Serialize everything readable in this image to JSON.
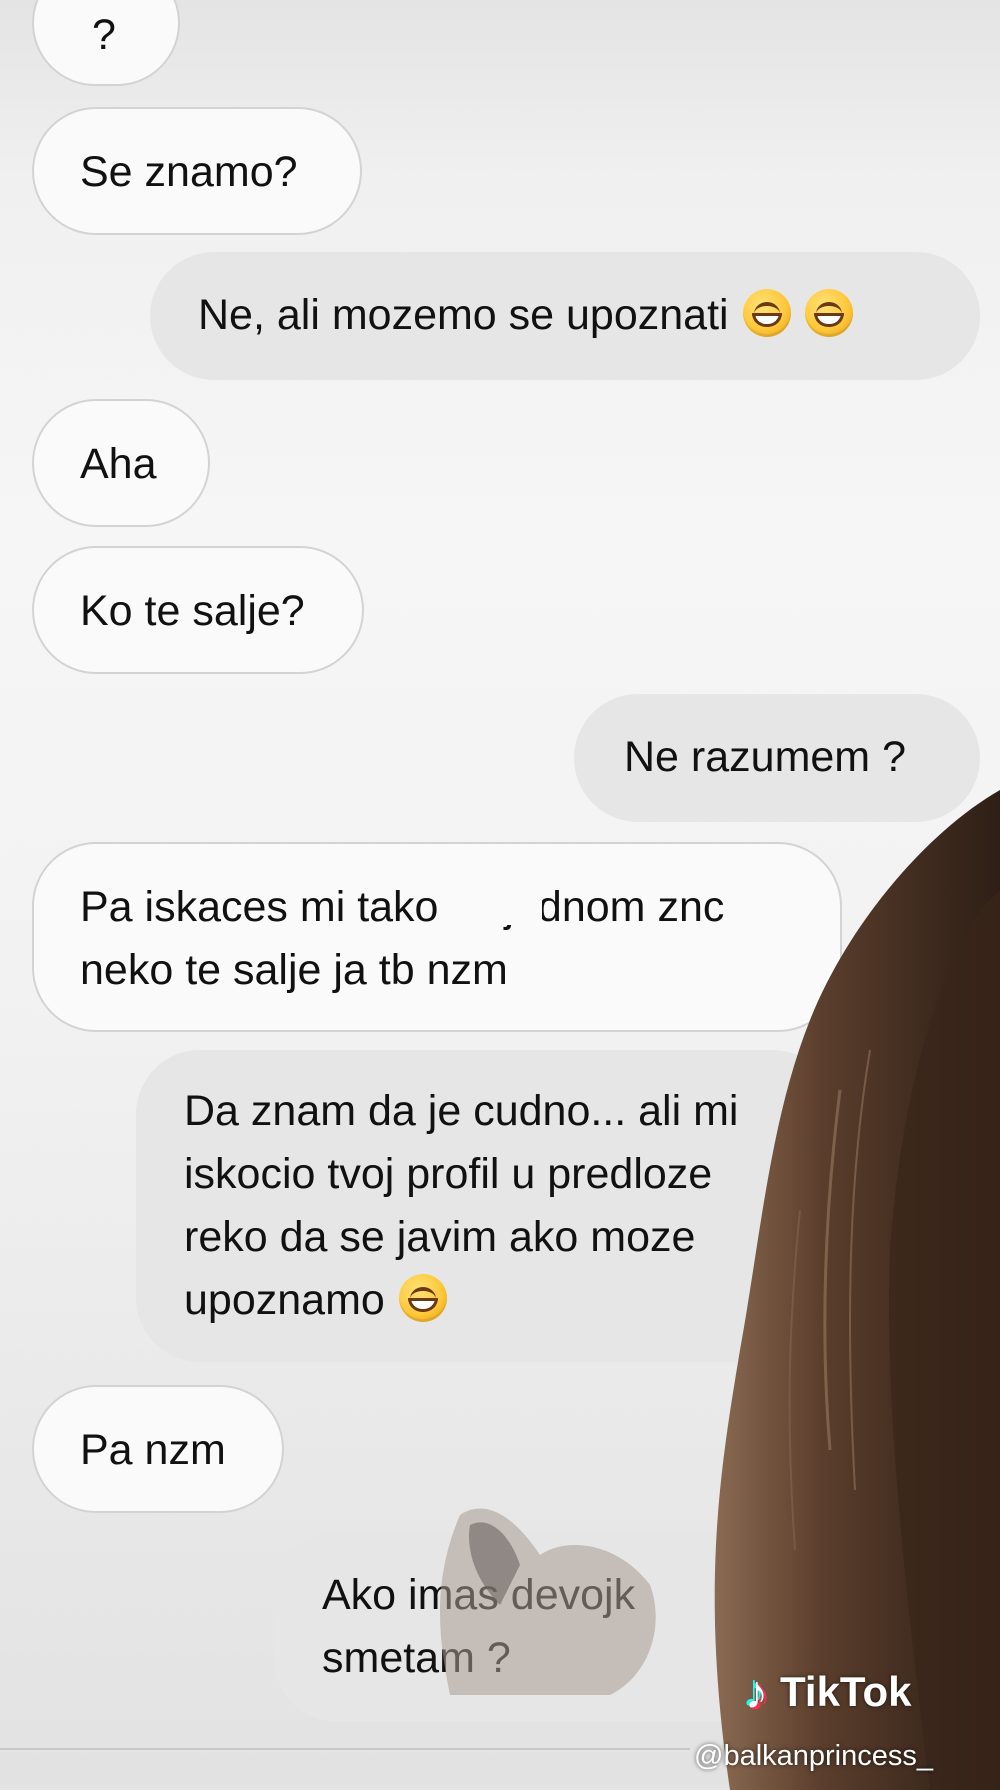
{
  "messages": [
    {
      "side": "in",
      "text": "?"
    },
    {
      "side": "in",
      "text": "Se znamo?"
    },
    {
      "side": "out",
      "text": "Ne, ali mozemo se upoznati",
      "emoji": [
        "grinning-face",
        "grinning-face"
      ]
    },
    {
      "side": "in",
      "text": "Aha"
    },
    {
      "side": "in",
      "text": "Ko te salje?"
    },
    {
      "side": "out",
      "text": "Ne razumem ?"
    },
    {
      "side": "in",
      "lines": [
        "Pa iskaces mi tako",
        "jednom znc",
        "neko te salje ja tb nzm"
      ]
    },
    {
      "side": "out",
      "lines": [
        "Da znam da je cudno... ali mi",
        "iskocio tvoj profil u predloze",
        "reko da se javim ako moze",
        "upoznamo"
      ],
      "emoji": [
        "grinning-face"
      ]
    },
    {
      "side": "in",
      "text": "Pa nzm"
    },
    {
      "side": "out",
      "lines": [
        "Ako imas devojk",
        "smetam ?"
      ]
    }
  ],
  "watermark": {
    "brand": "TikTok",
    "handle": "@balkanprincess_"
  },
  "colors": {
    "incoming_bubble": "#fafafa",
    "outgoing_bubble": "#e6e6e6",
    "background": "#f2f2f2"
  }
}
